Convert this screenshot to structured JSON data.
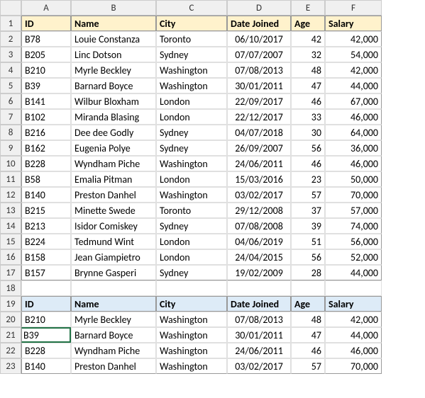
{
  "columns": [
    "A",
    "B",
    "C",
    "D",
    "E",
    "F"
  ],
  "rows": [
    "1",
    "2",
    "3",
    "4",
    "5",
    "6",
    "7",
    "8",
    "9",
    "10",
    "11",
    "12",
    "13",
    "14",
    "15",
    "16",
    "17",
    "18",
    "19",
    "20",
    "21",
    "22",
    "23"
  ],
  "header1": {
    "id": "ID",
    "name": "Name",
    "city": "City",
    "date": "Date Joined",
    "age": "Age",
    "salary": "Salary"
  },
  "data1": [
    {
      "id": "B78",
      "name": "Louie Constanza",
      "city": "Toronto",
      "date": "06/10/2017",
      "age": "42",
      "salary": "42,000"
    },
    {
      "id": "B205",
      "name": "Linc Dotson",
      "city": "Sydney",
      "date": "07/07/2007",
      "age": "32",
      "salary": "54,000"
    },
    {
      "id": "B210",
      "name": "Myrle Beckley",
      "city": "Washington",
      "date": "07/08/2013",
      "age": "48",
      "salary": "42,000"
    },
    {
      "id": "B39",
      "name": "Barnard Boyce",
      "city": "Washington",
      "date": "30/01/2011",
      "age": "47",
      "salary": "44,000"
    },
    {
      "id": "B141",
      "name": "Wilbur Bloxham",
      "city": "London",
      "date": "22/09/2017",
      "age": "46",
      "salary": "67,000"
    },
    {
      "id": "B102",
      "name": "Miranda Blasing",
      "city": "London",
      "date": "22/12/2017",
      "age": "33",
      "salary": "46,000"
    },
    {
      "id": "B216",
      "name": "Dee dee Godly",
      "city": "Sydney",
      "date": "04/07/2018",
      "age": "30",
      "salary": "64,000"
    },
    {
      "id": "B162",
      "name": "Eugenia Polye",
      "city": "Sydney",
      "date": "26/09/2007",
      "age": "56",
      "salary": "36,000"
    },
    {
      "id": "B228",
      "name": "Wyndham Piche",
      "city": "Washington",
      "date": "24/06/2011",
      "age": "46",
      "salary": "46,000"
    },
    {
      "id": "B58",
      "name": "Emalia Pitman",
      "city": "London",
      "date": "15/03/2016",
      "age": "23",
      "salary": "50,000"
    },
    {
      "id": "B140",
      "name": "Preston Danhel",
      "city": "Washington",
      "date": "03/02/2017",
      "age": "57",
      "salary": "70,000"
    },
    {
      "id": "B215",
      "name": "Minette Swede",
      "city": "Toronto",
      "date": "29/12/2008",
      "age": "37",
      "salary": "57,000"
    },
    {
      "id": "B213",
      "name": "Isidor Comiskey",
      "city": "Sydney",
      "date": "07/08/2008",
      "age": "39",
      "salary": "74,000"
    },
    {
      "id": "B224",
      "name": "Tedmund Wint",
      "city": "London",
      "date": "04/06/2019",
      "age": "51",
      "salary": "56,000"
    },
    {
      "id": "B158",
      "name": "Jean Giampietro",
      "city": "London",
      "date": "24/04/2015",
      "age": "56",
      "salary": "52,000"
    },
    {
      "id": "B157",
      "name": "Brynne Gasperi",
      "city": "Sydney",
      "date": "19/02/2009",
      "age": "28",
      "salary": "44,000"
    }
  ],
  "header2": {
    "id": "ID",
    "name": "Name",
    "city": "City",
    "date": "Date Joined",
    "age": "Age",
    "salary": "Salary"
  },
  "data2": [
    {
      "id": "B210",
      "name": "Myrle Beckley",
      "city": "Washington",
      "date": "07/08/2013",
      "age": "48",
      "salary": "42,000"
    },
    {
      "id": "B39",
      "name": "Barnard Boyce",
      "city": "Washington",
      "date": "30/01/2011",
      "age": "47",
      "salary": "44,000"
    },
    {
      "id": "B228",
      "name": "Wyndham Piche",
      "city": "Washington",
      "date": "24/06/2011",
      "age": "46",
      "salary": "46,000"
    },
    {
      "id": "B140",
      "name": "Preston Danhel",
      "city": "Washington",
      "date": "03/02/2017",
      "age": "57",
      "salary": "70,000"
    }
  ],
  "active_cell": "A21"
}
